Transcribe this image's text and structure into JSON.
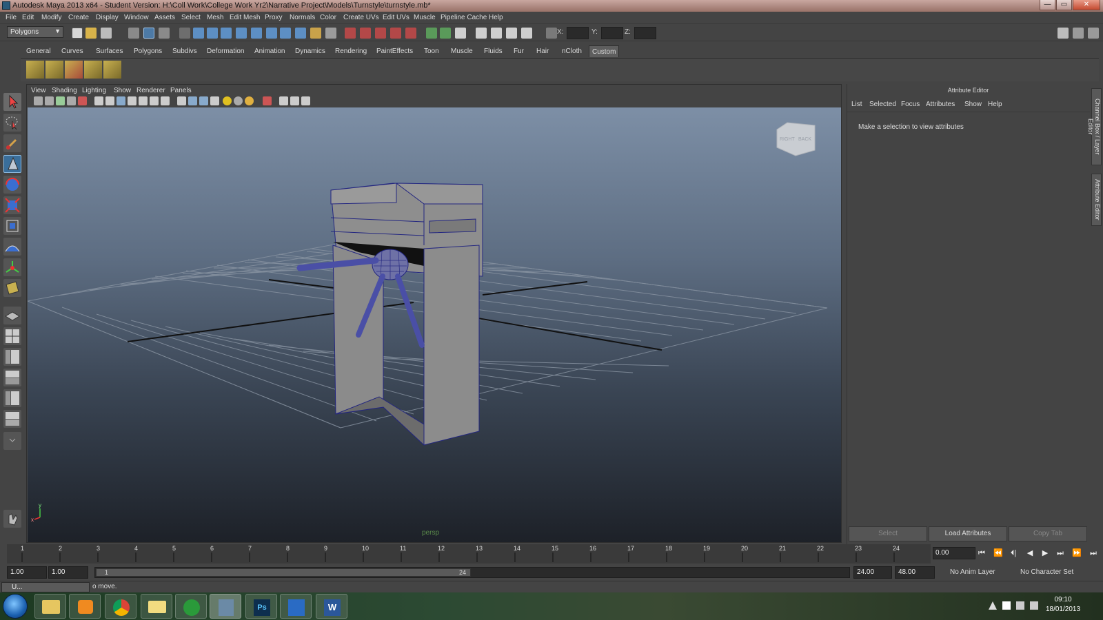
{
  "window": {
    "title": "Autodesk Maya 2013 x64 - Student Version: H:\\Coll Work\\College Work Yr2\\Narrative Project\\Models\\Turnstyle\\turnstyle.mb*",
    "minimize": "—",
    "maximize": "▭",
    "close": "✕"
  },
  "menubar": [
    "File",
    "Edit",
    "Modify",
    "Create",
    "Display",
    "Window",
    "Assets",
    "Select",
    "Mesh",
    "Edit Mesh",
    "Proxy",
    "Normals",
    "Color",
    "Create UVs",
    "Edit UVs",
    "Muscle",
    "Pipeline Cache",
    "Help"
  ],
  "statusline": {
    "mode": "Polygons",
    "mode_arrow": "▼",
    "x_label": "X:",
    "y_label": "Y:",
    "z_label": "Z:"
  },
  "shelf_tabs": [
    "General",
    "Curves",
    "Surfaces",
    "Polygons",
    "Subdivs",
    "Deformation",
    "Animation",
    "Dynamics",
    "Rendering",
    "PaintEffects",
    "Toon",
    "Muscle",
    "Fluids",
    "Fur",
    "Hair",
    "nCloth",
    "Custom"
  ],
  "viewport": {
    "menus": [
      "View",
      "Shading",
      "Lighting",
      "Show",
      "Renderer",
      "Panels"
    ],
    "camera_name": "persp",
    "viewcube_left": "RIGHT",
    "viewcube_right": "BACK",
    "axis_y": "y",
    "axis_x": "x"
  },
  "attribute_editor": {
    "title": "Attribute Editor",
    "menus": [
      "List",
      "Selected",
      "Focus",
      "Attributes",
      "Show",
      "Help"
    ],
    "message": "Make a selection to view attributes",
    "buttons": {
      "select": "Select",
      "load": "Load Attributes",
      "copy": "Copy Tab"
    },
    "side_tabs": [
      "Channel Box / Layer Editor",
      "Attribute Editor"
    ]
  },
  "timeslider": {
    "ticks": [
      "1",
      "2",
      "3",
      "4",
      "5",
      "6",
      "7",
      "8",
      "9",
      "10",
      "11",
      "12",
      "13",
      "14",
      "15",
      "16",
      "17",
      "18",
      "19",
      "20",
      "21",
      "22",
      "23",
      "24"
    ],
    "current_frame": "0.00",
    "playback": [
      "⏮",
      "⏪",
      "⏴|",
      "◀",
      "▶",
      "⏭",
      "⏩",
      "⏭"
    ]
  },
  "range_slider": {
    "start": "1.00",
    "start2": "1.00",
    "handle_start": "1",
    "handle_end": "24",
    "end": "24.00",
    "end2": "48.00",
    "anim_layer": "No Anim Layer",
    "char_set": "No Character Set"
  },
  "helpline": {
    "mini_window": "U...",
    "text": "o move."
  },
  "taskbar": {
    "clock_time": "09:10",
    "clock_date": "18/01/2013",
    "apps": [
      "explorer",
      "media-player",
      "chrome",
      "folder",
      "utorrent",
      "maya",
      "photoshop",
      "outlook",
      "word"
    ],
    "ps_label": "Ps",
    "word_label": "W"
  }
}
